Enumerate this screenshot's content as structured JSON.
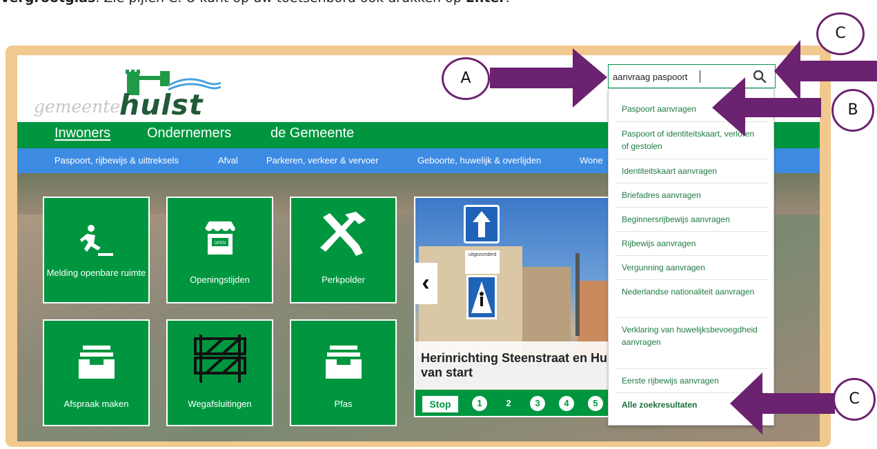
{
  "caption": {
    "bold1": "Vergrootglas",
    "text": ". Zie pijlen C. U kunt op uw toetsenbord ook drukken op ",
    "bold2": "Enter",
    "end": "."
  },
  "logo": {
    "prefix": "gemeente",
    "name": "hulst"
  },
  "search": {
    "value": "aanvraag paspoort",
    "icon": "search-icon"
  },
  "topnav": {
    "items": [
      "Inwoners",
      "Ondernemers",
      "de Gemeente"
    ],
    "active": "Inwoners"
  },
  "subnav": {
    "items": [
      "Paspoort, rijbewijs & uittreksels",
      "Afval",
      "Parkeren, verkeer & vervoer",
      "Geboorte, huwelijk & overlijden",
      "Wone"
    ]
  },
  "tiles": [
    {
      "label": "Melding openbare ruimte",
      "icon": "slip-person-icon"
    },
    {
      "label": "Openingstijden",
      "icon": "shop-open-icon"
    },
    {
      "label": "Perkpolder",
      "icon": "tools-icon"
    },
    {
      "label": "Afspraak maken",
      "icon": "inbox-tray-icon"
    },
    {
      "label": "Wegafsluitingen",
      "icon": "road-barrier-icon"
    },
    {
      "label": "Pfas",
      "icon": "inbox-tray-icon"
    }
  ],
  "slider": {
    "title": "Herinrichting Steenstraat en Hulst van start",
    "stop": "Stop",
    "pages": [
      "1",
      "2",
      "3",
      "4",
      "5"
    ],
    "current": "2",
    "sign_text": "uitgezonderd",
    "prev_icon": "chevron-left-icon"
  },
  "suggestions": [
    "Paspoort aanvragen",
    "Paspoort of identiteitskaart, verloren of gestolen",
    "Identiteitskaart aanvragen",
    "Briefadres aanvragen",
    "Beginnersrijbewijs aanvragen",
    "Rijbewijs aanvragen",
    "Vergunning aanvragen",
    "Nederlandse nationaliteit aanvragen",
    "Verklaring van huwelijksbevoegdheid aanvragen",
    "Eerste rijbewijs aanvragen"
  ],
  "all_results": "Alle zoekresultaten",
  "annotations": {
    "a": "A",
    "b": "B",
    "c1": "C",
    "c2": "C",
    "color": "#6b2270"
  },
  "colors": {
    "green": "#00963f",
    "blue": "#3d8be3",
    "frame": "#f1c88d"
  }
}
